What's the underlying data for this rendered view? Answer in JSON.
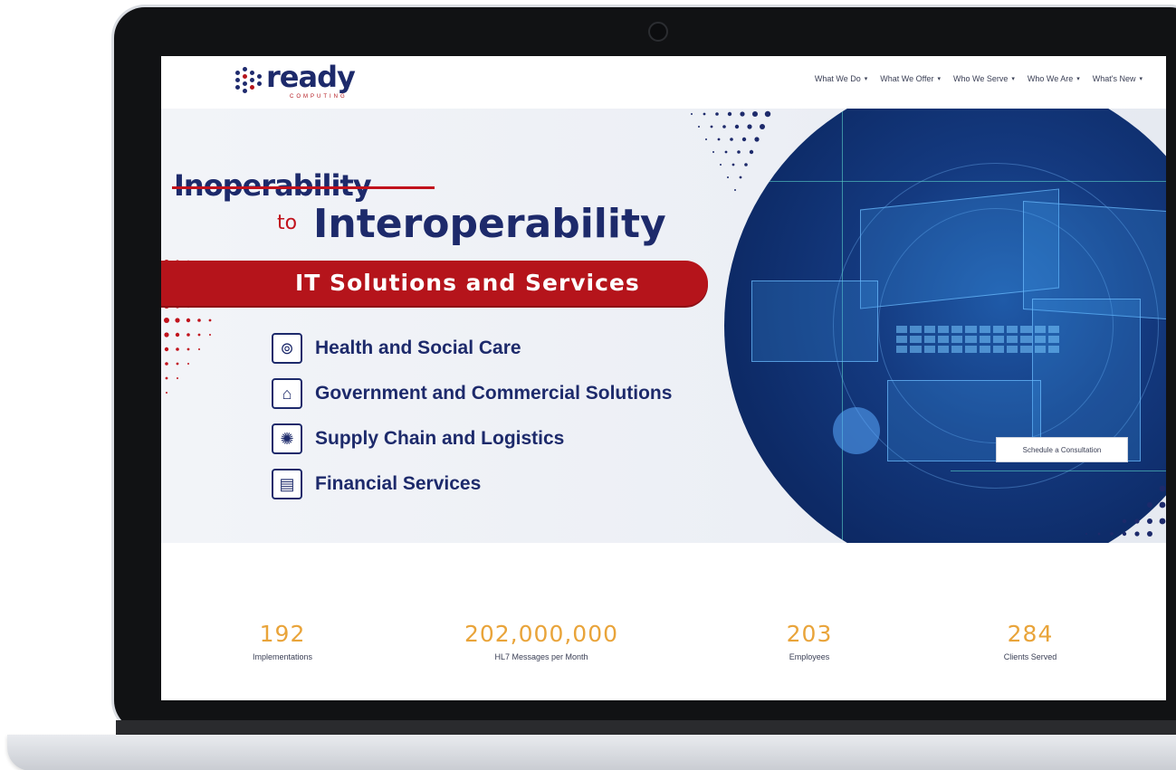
{
  "brand": {
    "name": "ready",
    "tagline": "COMPUTING",
    "colors": {
      "navy": "#1d2a6b",
      "red": "#b5141b",
      "gold": "#e9a43a"
    }
  },
  "nav": {
    "items": [
      {
        "label": "What We Do"
      },
      {
        "label": "What We Offer"
      },
      {
        "label": "Who We Serve"
      },
      {
        "label": "Who We Are"
      },
      {
        "label": "What's New"
      }
    ],
    "caret_icon": "chevron-down-icon"
  },
  "hero": {
    "struck_word": "Inoperability",
    "connector": "to",
    "headline": "Interoperability",
    "ribbon": "IT Solutions and Services",
    "sectors": [
      {
        "label": "Health and Social Care",
        "icon": "clipboard-medical-icon"
      },
      {
        "label": "Government and Commercial Solutions",
        "icon": "government-building-icon"
      },
      {
        "label": "Supply Chain and Logistics",
        "icon": "globe-network-icon"
      },
      {
        "label": "Financial Services",
        "icon": "calculator-chart-icon"
      }
    ],
    "cta": "Schedule a Consultation"
  },
  "stats": [
    {
      "value": "192",
      "label": "Implementations"
    },
    {
      "value": "202,000,000",
      "label": "HL7 Messages per Month"
    },
    {
      "value": "203",
      "label": "Employees"
    },
    {
      "value": "284",
      "label": "Clients Served"
    }
  ]
}
